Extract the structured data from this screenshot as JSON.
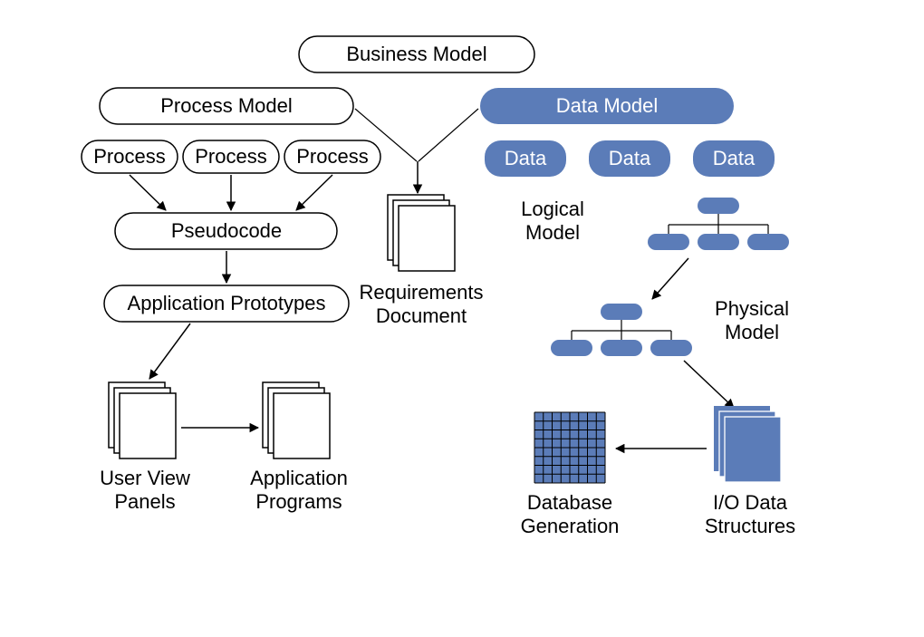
{
  "nodes": {
    "business_model": "Business Model",
    "process_model": "Process Model",
    "data_model": "Data Model",
    "process1": "Process",
    "process2": "Process",
    "process3": "Process",
    "data1": "Data",
    "data2": "Data",
    "data3": "Data",
    "pseudocode": "Pseudocode",
    "application_prototypes": "Application Prototypes",
    "logical_model": "Logical Model",
    "physical_model": "Physical Model"
  },
  "captions": {
    "requirements_document_l1": "Requirements",
    "requirements_document_l2": "Document",
    "user_view_panels_l1": "User View",
    "user_view_panels_l2": "Panels",
    "application_programs_l1": "Application",
    "application_programs_l2": "Programs",
    "database_generation_l1": "Database",
    "database_generation_l2": "Generation",
    "io_data_structures_l1": "I/O Data",
    "io_data_structures_l2": "Structures",
    "logical_model_l1": "Logical",
    "logical_model_l2": "Model",
    "physical_model_l1": "Physical",
    "physical_model_l2": "Model"
  }
}
